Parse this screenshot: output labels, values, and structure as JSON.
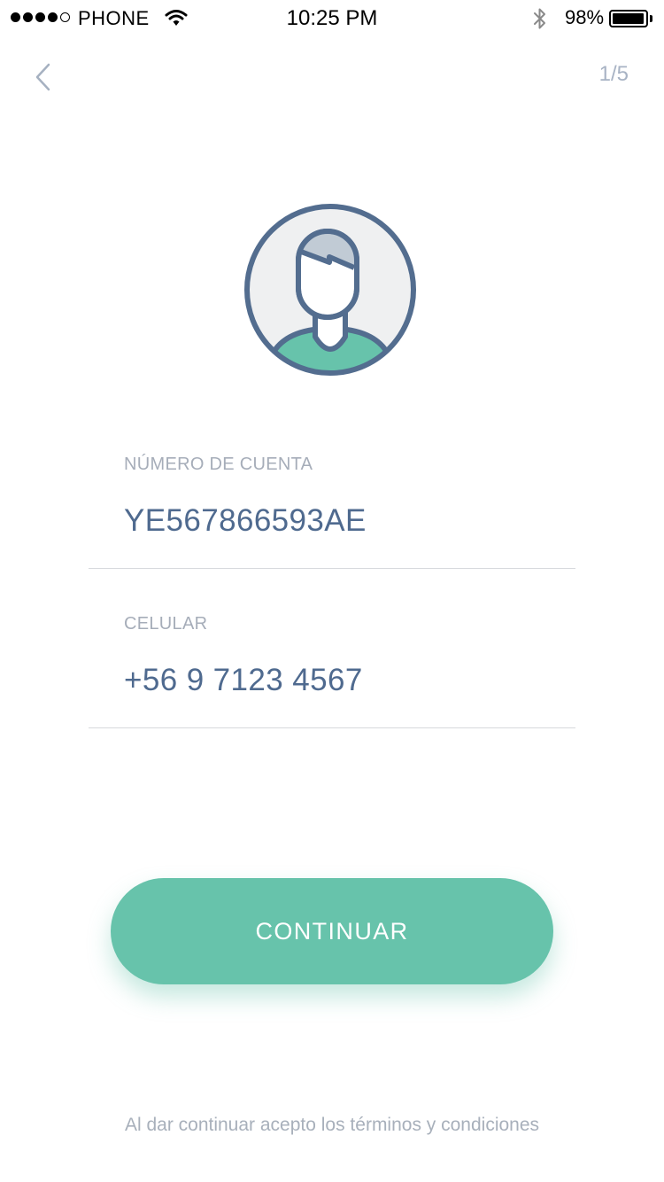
{
  "status_bar": {
    "carrier": "PHONE",
    "time": "10:25 PM",
    "battery_percent": "98%",
    "battery_level": 0.98,
    "signal_bars_filled": 4,
    "signal_bars_total": 5
  },
  "nav": {
    "back_icon": "chevron-left-icon",
    "step": "1/5"
  },
  "avatar": {
    "icon": "user-avatar-icon",
    "colors": {
      "ring": "#536d8f",
      "background": "#eff0f1",
      "hair": "#c1cbd5",
      "shirt": "#67c3ab"
    }
  },
  "form": {
    "account_label": "NÚMERO DE CUENTA",
    "account_value": "YE567866593AE",
    "phone_label": "CELULAR",
    "phone_value": "+56 9 7123 4567"
  },
  "cta": {
    "label": "CONTINUAR",
    "color": "#67c3ab"
  },
  "footer": {
    "terms": "Al dar continuar acepto los términos y condiciones"
  },
  "colors": {
    "value_text": "#4f6a8f",
    "label_text": "#a6adb9",
    "accent": "#67c3ab"
  }
}
